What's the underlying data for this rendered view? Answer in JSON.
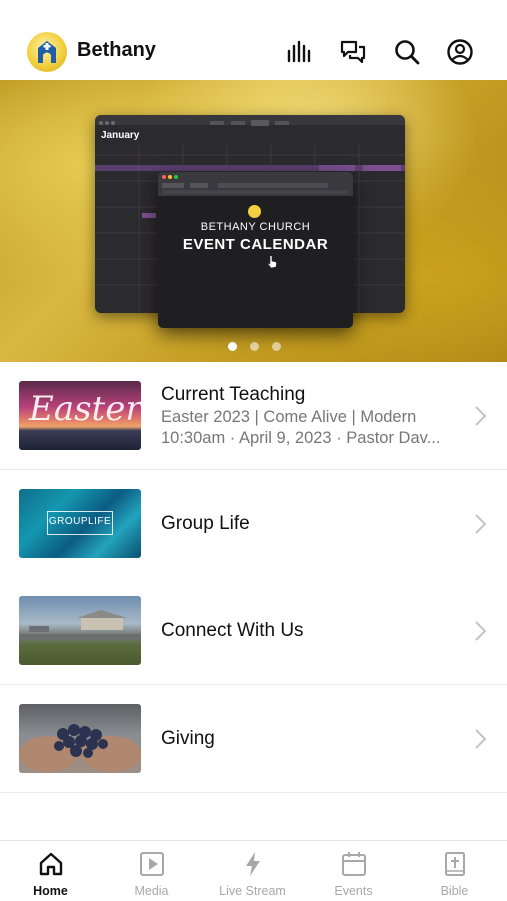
{
  "app": {
    "name": "Bethany"
  },
  "header": {
    "icons": [
      "podcast-icon",
      "chat-icon",
      "search-icon",
      "account-icon"
    ]
  },
  "hero": {
    "calendar_month": "January",
    "slide_title_line1": "BETHANY CHURCH",
    "slide_title_line2": "EVENT CALENDAR",
    "slides_count": 3,
    "active_slide": 1
  },
  "list": [
    {
      "title": "Current Teaching",
      "subtitle1": "Easter 2023 | Come Alive | Modern",
      "subtitle2": "10:30am · April 9, 2023 · Pastor Dav...",
      "thumb_text": "Easter"
    },
    {
      "title": "Group Life",
      "thumb_text": "GROUPLIFE"
    },
    {
      "title": "Connect With Us"
    },
    {
      "title": "Giving"
    }
  ],
  "tabs": [
    {
      "label": "Home",
      "icon": "home-icon",
      "active": true
    },
    {
      "label": "Media",
      "icon": "media-icon",
      "active": false
    },
    {
      "label": "Live Stream",
      "icon": "lightning-icon",
      "active": false
    },
    {
      "label": "Events",
      "icon": "calendar-icon",
      "active": false
    },
    {
      "label": "Bible",
      "icon": "bible-icon",
      "active": false
    }
  ],
  "colors": {
    "accent": "#f2cf3c",
    "inactive_tab": "#a8a8a8",
    "active_tab": "#111111"
  }
}
